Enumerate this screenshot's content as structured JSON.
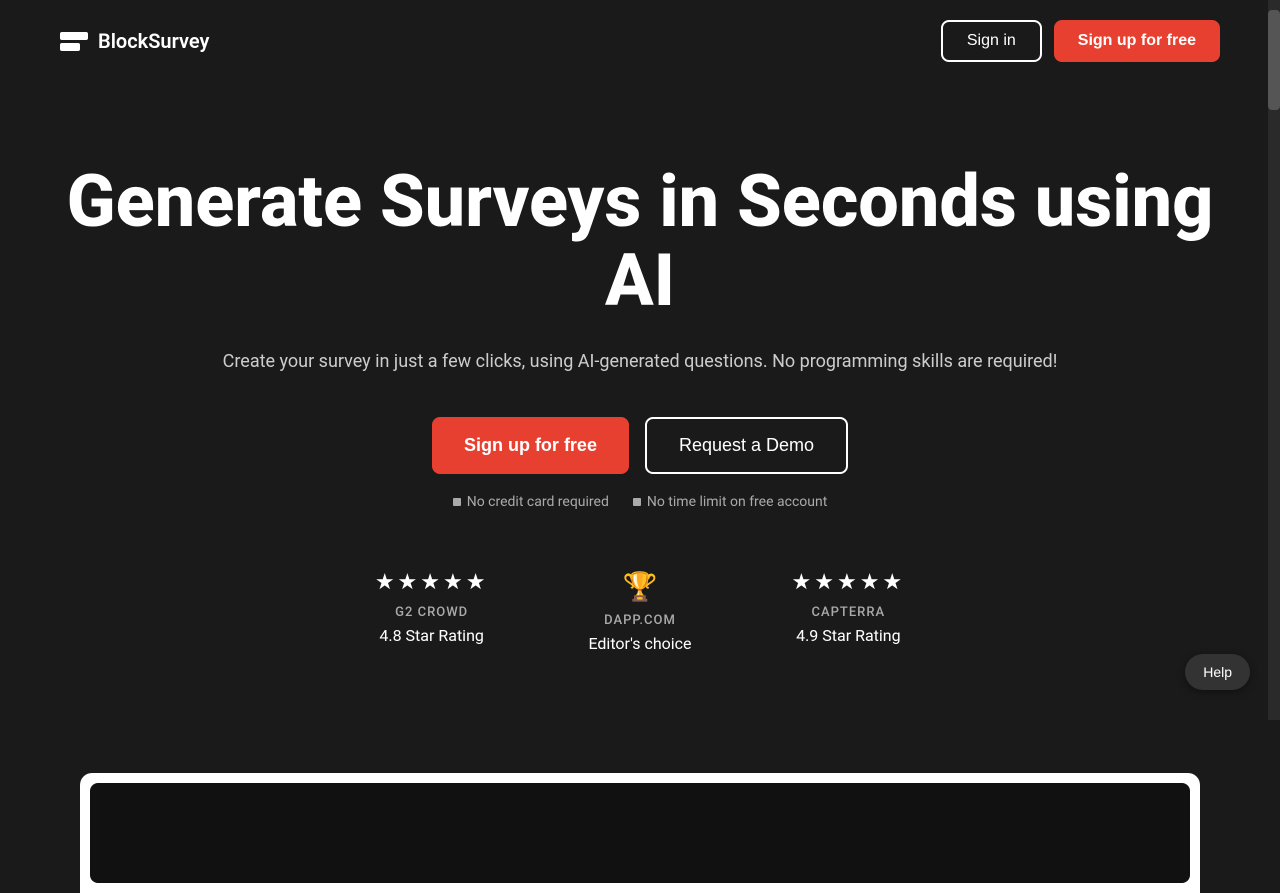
{
  "brand": {
    "name": "BlockSurvey"
  },
  "nav": {
    "signin_label": "Sign in",
    "signup_label": "Sign up for free"
  },
  "hero": {
    "title": "Generate Surveys in Seconds using AI",
    "subtitle": "Create your survey in just a few clicks, using AI-generated questions. No programming skills are required!",
    "cta_primary": "Sign up for free",
    "cta_secondary": "Request a Demo",
    "note1": "No credit card required",
    "note2": "No time limit on free account"
  },
  "ratings": [
    {
      "id": "g2",
      "type": "stars",
      "stars": "★★★★★",
      "source": "G2 CROWD",
      "label": "4.8 Star Rating"
    },
    {
      "id": "dapp",
      "type": "trophy",
      "source": "DAPP.COM",
      "label": "Editor's choice"
    },
    {
      "id": "capterra",
      "type": "stars",
      "stars": "★★★★★",
      "source": "CAPTERRA",
      "label": "4.9 Star Rating"
    }
  ],
  "help": {
    "label": "Help"
  }
}
